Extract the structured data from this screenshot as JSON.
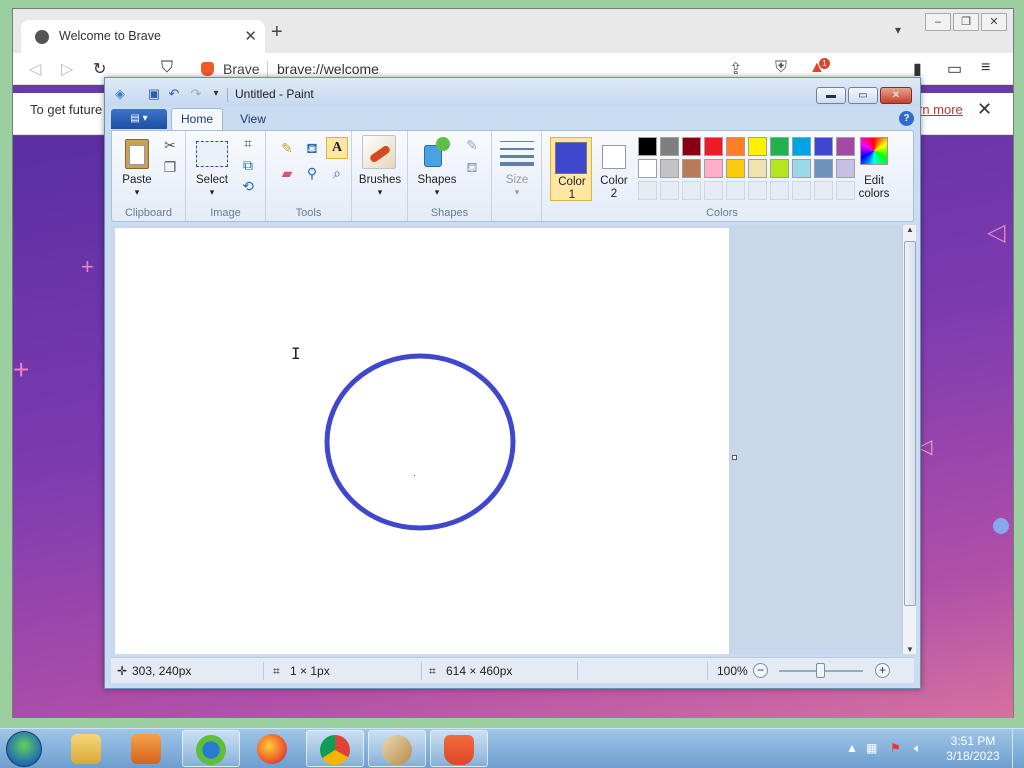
{
  "browser": {
    "tab_title": "Welcome to Brave",
    "address_brand": "Brave",
    "address_url": "brave://welcome",
    "infobar_text": "To get future",
    "infobar_link": "rn more",
    "badge_count": "1"
  },
  "paint": {
    "window_title": "Untitled - Paint",
    "tabs": {
      "home": "Home",
      "view": "View"
    },
    "groups": {
      "clipboard": "Clipboard",
      "image": "Image",
      "tools": "Tools",
      "shapes": "Shapes",
      "colors": "Colors"
    },
    "buttons": {
      "paste": "Paste",
      "select": "Select",
      "brushes": "Brushes",
      "shapes": "Shapes",
      "size": "Size",
      "color1_line1": "Color",
      "color1_line2": "1",
      "color2_line1": "Color",
      "color2_line2": "2",
      "edit_colors_line1": "Edit",
      "edit_colors_line2": "colors"
    },
    "palette_row1": [
      "#000000",
      "#7f7f7f",
      "#880015",
      "#ed1c24",
      "#ff7f27",
      "#fff200",
      "#22b14c",
      "#00a2e8",
      "#3f48cc",
      "#a349a4"
    ],
    "palette_row2": [
      "#ffffff",
      "#c3c3c3",
      "#b97a57",
      "#ffaec9",
      "#ffc90e",
      "#efe4b0",
      "#b5e61d",
      "#99d9ea",
      "#7092be",
      "#c8bfe7"
    ],
    "primary_color": "#3f48cc",
    "secondary_color": "#ffffff",
    "status": {
      "cursor_pos": "303, 240px",
      "selection_size": "1 × 1px",
      "canvas_size": "614 × 460px",
      "zoom": "100%"
    }
  },
  "taskbar": {
    "time": "3:51 PM",
    "date": "3/18/2023"
  }
}
